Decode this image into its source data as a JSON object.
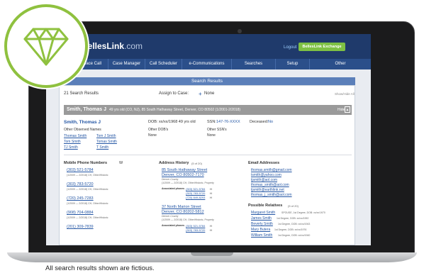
{
  "app": {
    "logo_main": "BellesLink",
    "logo_domain": ".com",
    "logout": "Logout",
    "exchange_button": "BellesLink Exchange"
  },
  "nav": [
    "ily",
    "Place Call",
    "Case Manager",
    "Call Scheduler",
    "e-Communications",
    "Searches",
    "Setup",
    "Other"
  ],
  "results": {
    "title": "Search Results",
    "count": "21 Search Results",
    "assign_label": "Assign to Case:",
    "assign_plus": "+",
    "assign_value": "None",
    "show_hide_all": "Show/Hide All"
  },
  "record": {
    "bar_name": "Smith, Thomas J",
    "bar_detail": "49 yrs old (CO, NJ), 85 South Hathaway Street, Denver, CO 80502 (1/2001-2/2018)",
    "hide": "Hide",
    "hide_icon": "caret-up-icon",
    "name": "Smith, Thomas J",
    "dob": "DOB: xx/xx/1968 49 yrs old",
    "ssn_label": "SSN:",
    "ssn_value": "147-76-XXXX",
    "deceased_label": "Deceased:",
    "deceased_value": "No",
    "other_names_label": "Other Observed Names",
    "other_names_col1": [
      "Thomas Smith",
      "Tom Smith",
      "TJ Smith"
    ],
    "other_names_col2": [
      "Tom J Smith",
      "Tomas Smith",
      "T Smith"
    ],
    "other_dob_label": "Other DOB's",
    "other_dob_value": "None",
    "other_ssn_label": "Other SSN's",
    "other_ssn_value": "None"
  },
  "phones": {
    "header": "Mobile Phone Numbers",
    "header_suffix": "W",
    "items": [
      {
        "number": "(303) 521-5784",
        "meta": "(1/2009 — 2/2018) CH, Other/Historic"
      },
      {
        "number": "(303) 783-5720",
        "meta": "(1/2009 — 2/2018) CH, Other/Historic"
      },
      {
        "number": "(720) 245-7283",
        "meta": "(1/2009 — 2/2018) CH, Other/Historic"
      },
      {
        "number": "(908) 704-0884",
        "meta": "(1/2009 — 2/2018) CH, Other/Historic"
      },
      {
        "number": "(201) 309-7839",
        "meta": ""
      }
    ]
  },
  "addresses": {
    "header": "Address History",
    "header_count": "(5 of 20)",
    "items": [
      {
        "line1": "85 South Hathaway Street",
        "line2": "Denver, CO 80502-7170",
        "county": "Denver County",
        "meta": "(1/2009 — 2/2018) CH, Other/Historic, Property",
        "assoc_label": "Associated phones",
        "phones": [
          "(303) 521-5784",
          "(303) 783-5720",
          "(720) 849-8293"
        ],
        "phone_suffix": [
          "H",
          "H",
          "H"
        ]
      },
      {
        "line1": "37 North Marion Street",
        "line2": "Denver, CO 80202-5812",
        "county": "Denver County",
        "meta": "(1/2009 — 2/2018) CH, Other/Historic, Property",
        "assoc_label": "Associated phones",
        "phones": [
          "(303) 521-5784",
          "(303) 783-5720"
        ],
        "phone_suffix": [
          "H",
          "H"
        ]
      }
    ]
  },
  "emails": {
    "header": "Email Addresses",
    "items": [
      "thomas.smith@gmail.com",
      "tsmith@yahoo.com",
      "tjsmith@aol.com",
      "thomas_smith@aol.com",
      "tjsmith@earthlink.net",
      "thomas_j_smith@aol.com"
    ]
  },
  "relatives": {
    "header": "Possible Relatives",
    "header_count": "(5 of 20)",
    "items": [
      {
        "name": "Margaret Smith",
        "meta": "SPOUSE, 1st Degree, DOB: xx/xx/1970"
      },
      {
        "name": "James Smith",
        "meta": "1st Degree, DOB: xx/xx/1992"
      },
      {
        "name": "Beverly Smith",
        "meta": "1st Degree, DOB: xx/xx/1943"
      },
      {
        "name": "Mary Butera",
        "meta": "1st Degree, DOB: xx/xx/1976"
      },
      {
        "name": "William Smith",
        "meta": "1st Degree, DOB: xx/xx/1940"
      }
    ]
  },
  "disclaimer": "All search results shown are fictious.",
  "colors": {
    "badge_green": "#8fc13f",
    "header_navy": "#1f3a6b",
    "nav_blue": "#2b4f8a",
    "results_bar": "#5b7fb9",
    "exchange_green": "#7ec144",
    "link_blue": "#2456a4"
  }
}
